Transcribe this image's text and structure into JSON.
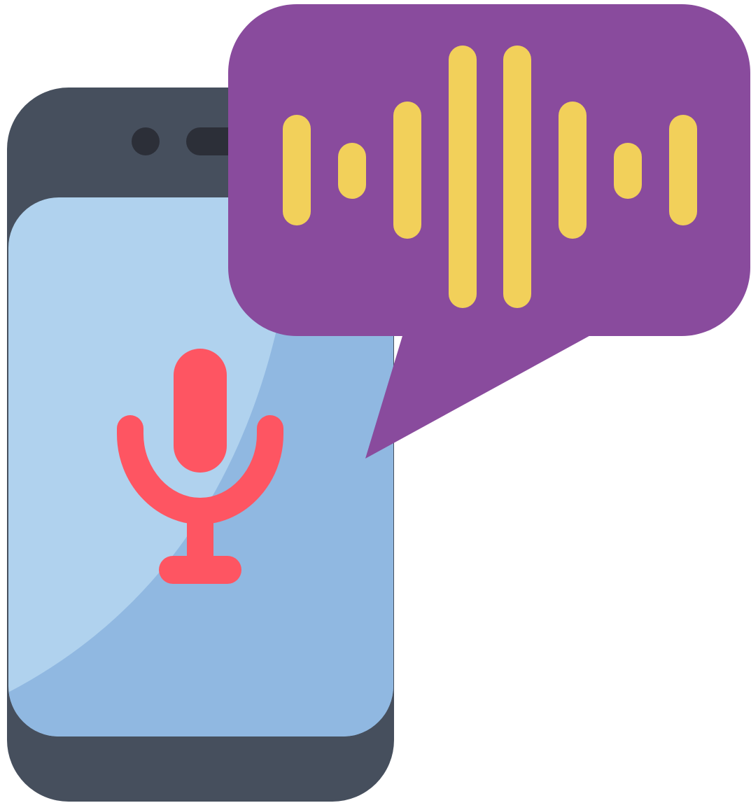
{
  "illustration": {
    "subject_icon": "smartphone-voice-assistant-icon",
    "elements": [
      "smartphone-icon",
      "microphone-icon",
      "speech-bubble-icon",
      "sound-wave-icon"
    ]
  },
  "colors": {
    "phone_body": "#464f5d",
    "phone_dark_detail": "#2c2f38",
    "screen_light": "#b0d2ee",
    "screen_shade": "#90b8e1",
    "microphone": "#fe5562",
    "bubble": "#894b9d",
    "sound_wave": "#f2d05a"
  }
}
